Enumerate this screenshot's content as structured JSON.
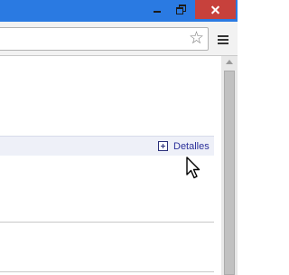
{
  "window": {
    "controls": [
      "minimize",
      "maximize",
      "close"
    ]
  },
  "toolbar": {
    "address_value": "",
    "bookmark_icon": "star-icon",
    "menu_icon": "hamburger-menu-icon"
  },
  "content": {
    "details_label": "Detalles",
    "details_icon": "plus-box-icon",
    "row_background": "#eef0f8",
    "link_color": "#2a2f9a"
  },
  "colors": {
    "titlebar": "#2a7ae2",
    "close_button": "#c7413c",
    "toolbar": "#f2f2f2"
  }
}
